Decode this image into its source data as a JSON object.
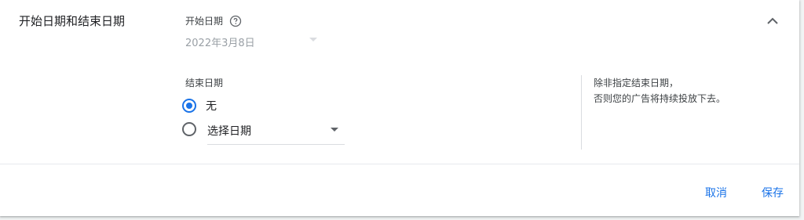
{
  "section": {
    "title": "开始日期和结束日期"
  },
  "start_date": {
    "label": "开始日期",
    "value": "2022年3月8日"
  },
  "end_date": {
    "label": "结束日期",
    "options": [
      {
        "label": "无",
        "selected": true
      },
      {
        "label": "选择日期",
        "selected": false
      }
    ]
  },
  "note": {
    "line1": "除非指定结束日期，",
    "line2": "否则您的广告将持续投放下去。"
  },
  "footer": {
    "cancel_label": "取消",
    "save_label": "保存"
  },
  "colors": {
    "accent": "#1a73e8",
    "text": "#202124",
    "muted": "#9aa0a6",
    "divider": "#dadce0"
  },
  "icons": {
    "collapse": "chevron-up-icon",
    "help": "help-circle-icon",
    "dropdown": "caret-down-icon"
  }
}
